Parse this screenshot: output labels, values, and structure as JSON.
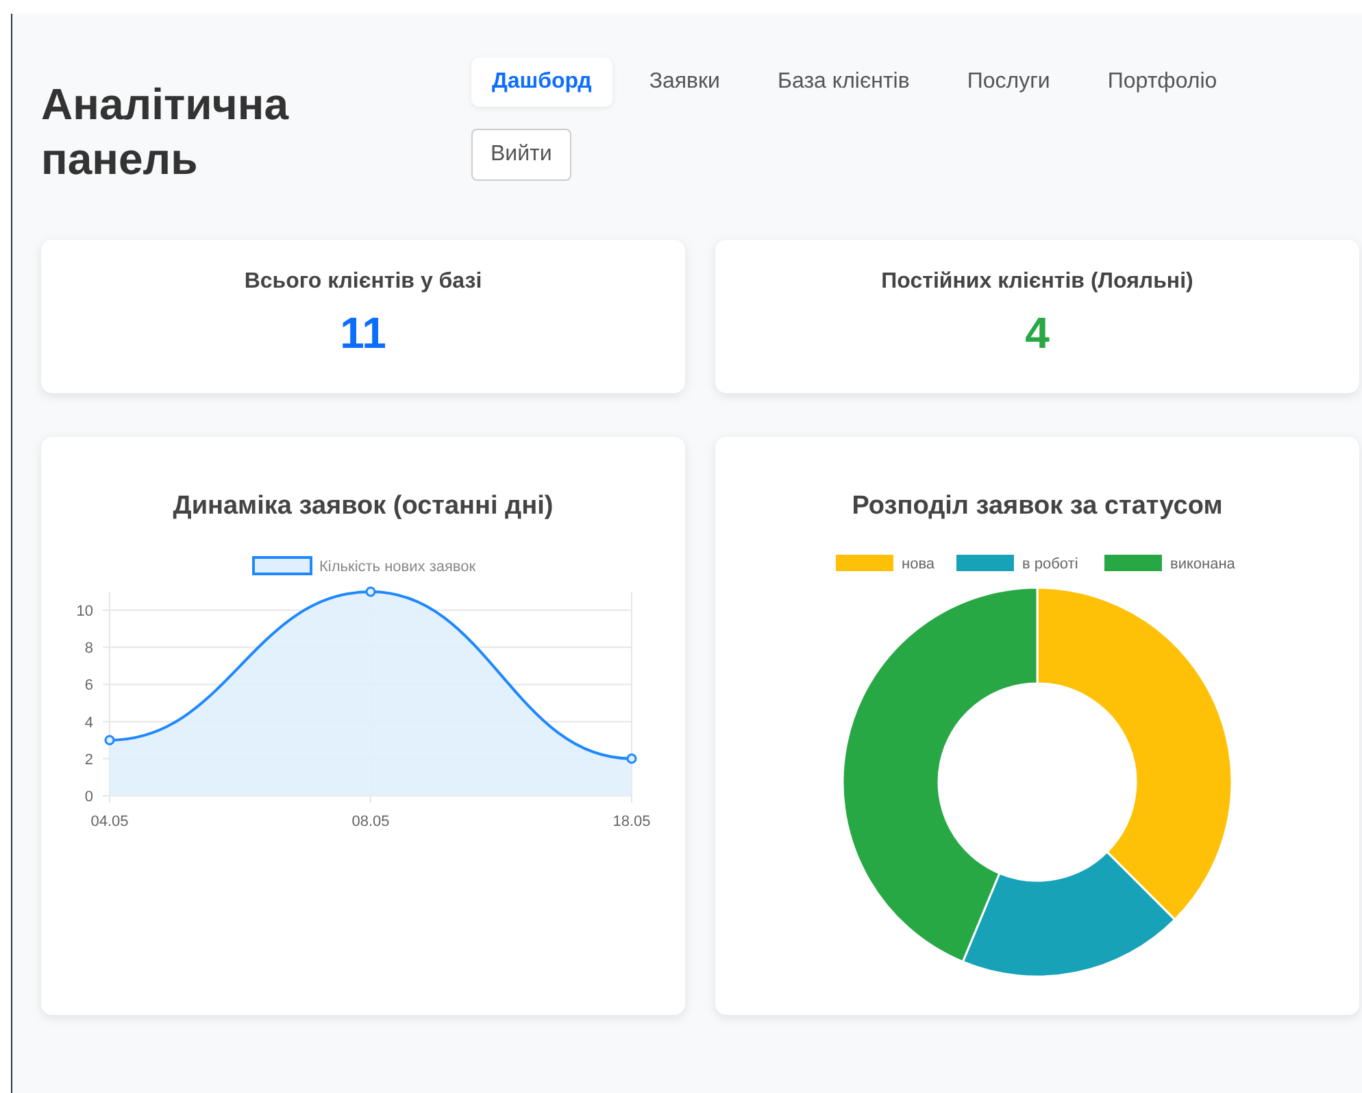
{
  "header": {
    "title": "Аналітична панель"
  },
  "nav": {
    "tabs": [
      {
        "label": "Дашборд",
        "selected": true
      },
      {
        "label": "Заявки",
        "selected": false
      },
      {
        "label": "База клієнтів",
        "selected": false
      },
      {
        "label": "Послуги",
        "selected": false
      },
      {
        "label": "Портфоліо",
        "selected": false
      }
    ],
    "logout": "Вийти"
  },
  "stats": [
    {
      "label": "Всього клієнтів у базі",
      "value": "11",
      "color": "#0d6efd"
    },
    {
      "label": "Постійних клієнтів (Лояльні)",
      "value": "4",
      "color": "#28a745"
    }
  ],
  "charts": [
    {
      "title": "Динаміка заявок (останні дні)",
      "chart_data": {
        "type": "area",
        "categories": [
          "04.05",
          "08.05",
          "18.05"
        ],
        "series": [
          {
            "name": "Кількість нових заявок",
            "color": "#1e88ff",
            "values": [
              3,
              11,
              2
            ]
          }
        ],
        "ylim": [
          0,
          11
        ],
        "yticks": [
          0,
          2,
          4,
          6,
          8,
          10
        ],
        "grid": true,
        "legend": true
      }
    },
    {
      "title": "Розподіл заявок за статусом",
      "chart_data": {
        "type": "donut",
        "categories": [
          "нова",
          "в роботі",
          "виконана"
        ],
        "values": [
          37.5,
          18.75,
          43.75
        ],
        "colors": [
          "#ffc107",
          "#17a2b8",
          "#28a745"
        ],
        "legend": true
      }
    }
  ]
}
